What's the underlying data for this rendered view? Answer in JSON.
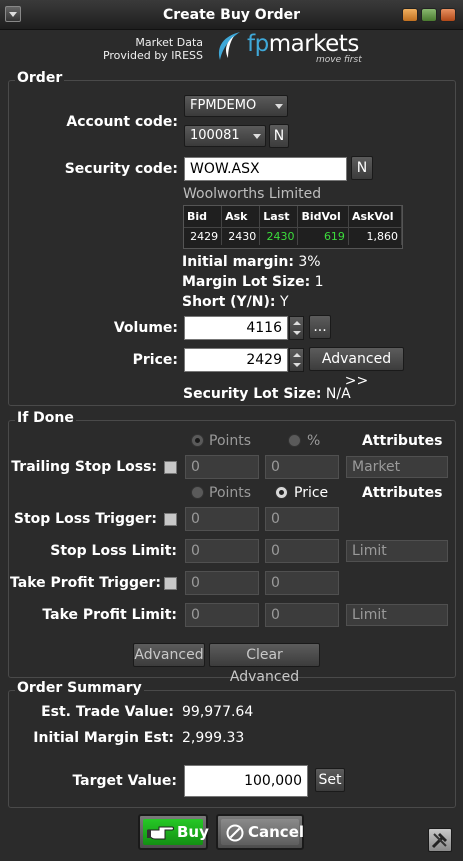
{
  "window": {
    "title": "Create Buy Order",
    "menu_icon": "chevron-down-icon",
    "controls": [
      "minimize-icon",
      "maximize-icon",
      "close-icon"
    ]
  },
  "brand": {
    "line1": "Market Data",
    "line2": "Provided by IRESS",
    "logo_prefix": "fp",
    "logo_name": "markets",
    "tagline": "move first"
  },
  "order": {
    "title": "Order",
    "account_label": "Account code:",
    "account_value": "FPMDEMO",
    "subaccount_value": "100081",
    "n_button": "N",
    "security_label": "Security code:",
    "security_value": "WOW.ASX",
    "security_n_button": "N",
    "security_name": "Woolworths Limited",
    "quote": {
      "headers": [
        "Bid",
        "Ask",
        "Last",
        "BidVol",
        "AskVol"
      ],
      "values": [
        "2429",
        "2430",
        "2430",
        "619",
        "1,860"
      ]
    },
    "initial_margin_label": "Initial margin:",
    "initial_margin_value": "3%",
    "margin_lot_label": "Margin Lot Size:",
    "margin_lot_value": "1",
    "short_label": "Short (Y/N):",
    "short_value": "Y",
    "volume_label": "Volume:",
    "volume_value": "4116",
    "ellipsis_button": "...",
    "price_label": "Price:",
    "price_value": "2429",
    "advanced_button": "Advanced >>",
    "security_lot_label": "Security Lot Size:",
    "security_lot_value": "N/A"
  },
  "if_done": {
    "title": "If Done",
    "points_label": "Points",
    "percent_label": "%",
    "price_label": "Price",
    "attributes_label": "Attributes",
    "trailing_stop_label": "Trailing Stop Loss:",
    "trailing_val1": "0",
    "trailing_val2": "0",
    "trailing_attr": "Market",
    "stop_trigger_label": "Stop Loss Trigger:",
    "stop_trigger_val1": "0",
    "stop_trigger_val2": "0",
    "stop_limit_label": "Stop Loss Limit:",
    "stop_limit_val1": "0",
    "stop_limit_val2": "0",
    "stop_limit_attr": "Limit",
    "tp_trigger_label": "Take Profit Trigger:",
    "tp_trigger_val1": "0",
    "tp_trigger_val2": "0",
    "tp_limit_label": "Take Profit Limit:",
    "tp_limit_val1": "0",
    "tp_limit_val2": "0",
    "tp_limit_attr": "Limit",
    "advanced_button": "Advanced",
    "clear_button": "Clear Advanced"
  },
  "summary": {
    "title": "Order Summary",
    "trade_value_label": "Est. Trade Value:",
    "trade_value": "99,977.64",
    "margin_est_label": "Initial Margin Est:",
    "margin_est_value": "2,999.33",
    "target_label": "Target Value:",
    "target_value": "100,000",
    "set_button": "Set"
  },
  "footer": {
    "buy_button": "Buy",
    "buy_icon": "pointing-hand-icon",
    "cancel_button": "Cancel",
    "cancel_icon": "cancel-circle-icon",
    "tools_icon": "tools-icon"
  },
  "colors": {
    "background": "#2b2b2b",
    "buy_green": "#1db31d",
    "quote_green": "#3cdc3c",
    "logo_blue": "#3fa8d8"
  }
}
